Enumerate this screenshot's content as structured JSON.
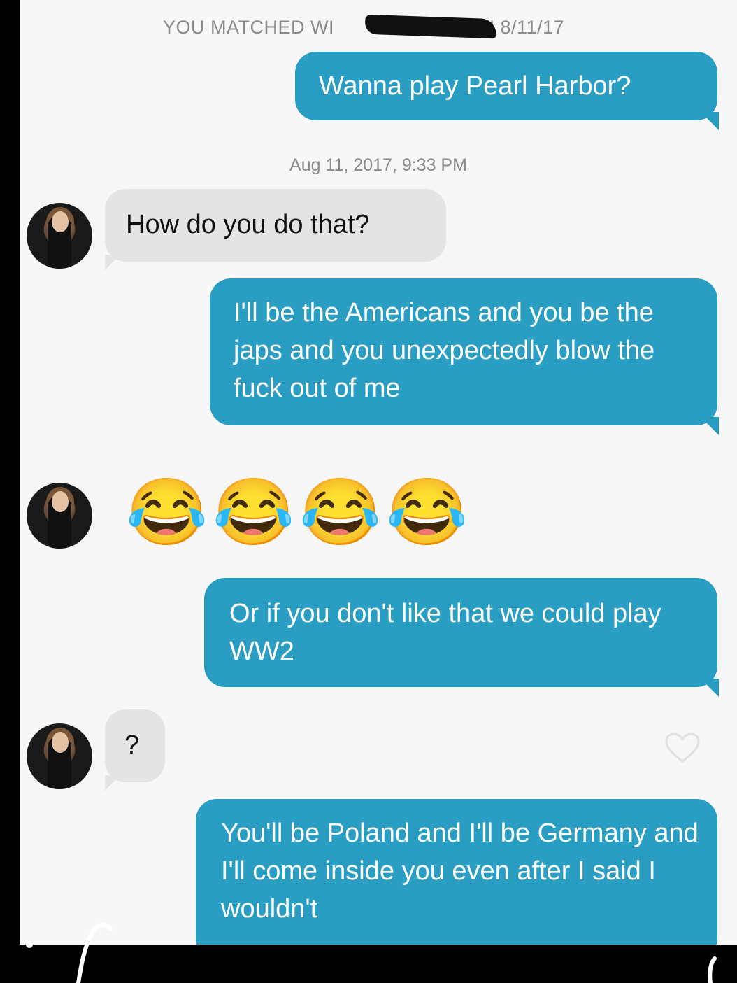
{
  "conversation": {
    "match_banner": "YOU MATCHED WI",
    "match_banner_tail": "ON 8/11/17",
    "timestamp": "Aug 11, 2017, 9:33 PM",
    "messages": [
      {
        "from": "me",
        "text": "Wanna play Pearl Harbor?"
      },
      {
        "from": "them",
        "text": "How do you do that?"
      },
      {
        "from": "me",
        "text": "I'll be the Americans and you be the japs and you unexpectedly blow the fuck out of me"
      },
      {
        "from": "them",
        "emoji": [
          "😂",
          "😂",
          "😂",
          "😂"
        ]
      },
      {
        "from": "me",
        "text": "Or if you don't like that we could play WW2"
      },
      {
        "from": "them",
        "text": "?"
      },
      {
        "from": "me",
        "text": "You'll be Poland and I'll be Germany and I'll come inside you even after I said I wouldn't"
      }
    ]
  },
  "colors": {
    "outgoing_bubble": "#2a9ec2",
    "incoming_bubble": "#e4e4e4",
    "background": "#f7f7f7"
  },
  "icons": {
    "like": "heart-outline-icon"
  }
}
